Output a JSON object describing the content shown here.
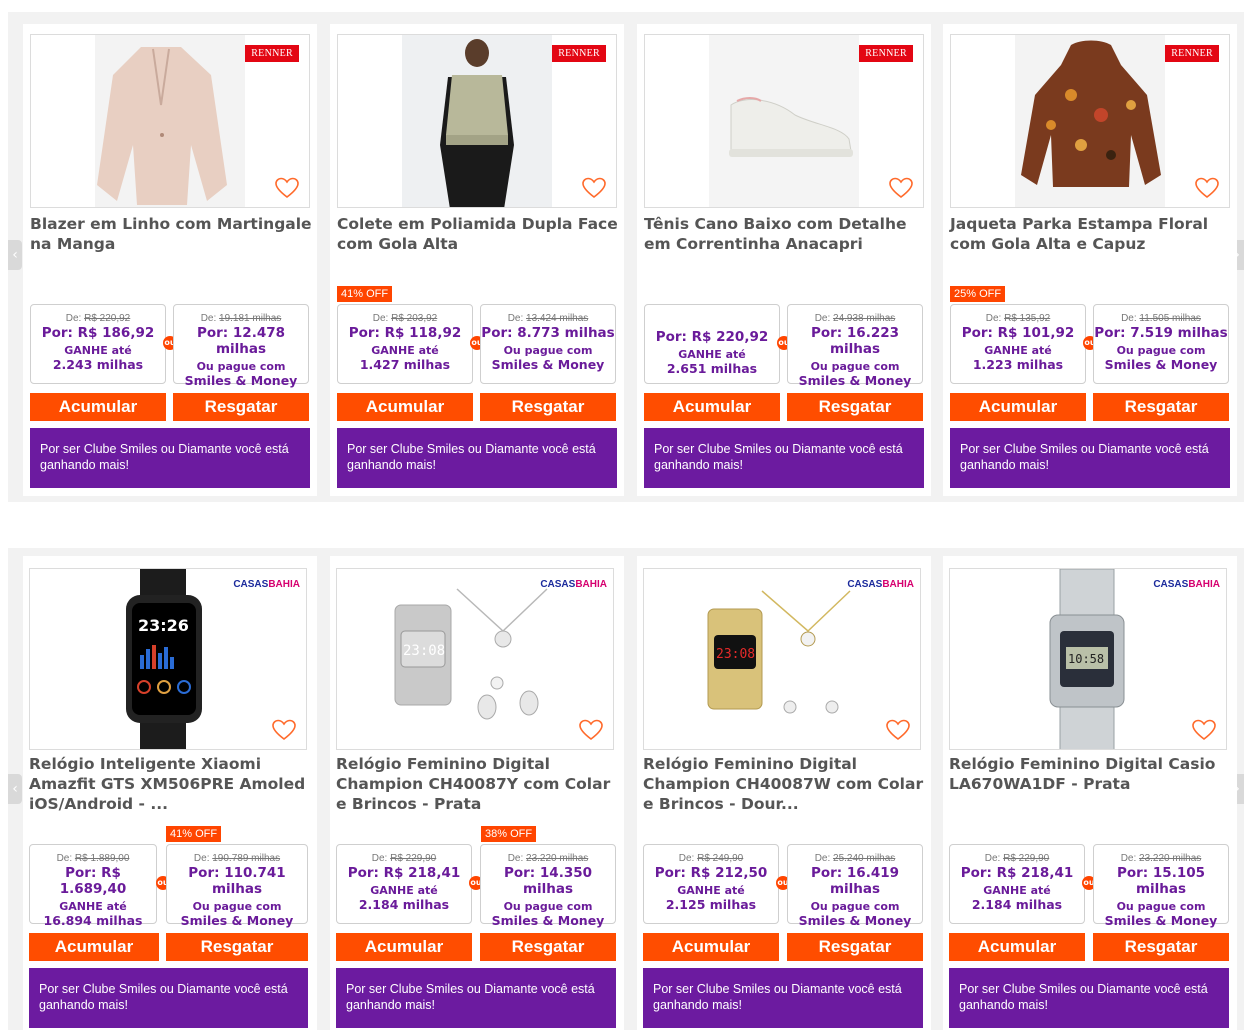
{
  "common": {
    "acumular": "Acumular",
    "resgatar": "Resgatar",
    "banner": "Por ser Clube Smiles ou Diamante você está ganhando mais!",
    "de_label": "De: ",
    "ganhe": "GANHE até",
    "ou_pague": "Ou pague com",
    "smiles_money": "Smiles & Money",
    "ou": "ou"
  },
  "brands": {
    "renner": "RENNER",
    "casas_a": "CASAS",
    "casas_b": "BAHIA"
  },
  "row1": [
    {
      "title": "Blazer em Linho com Martingale na Manga",
      "discount": "",
      "was_price": "R$ 220,92",
      "price": "Por: R$ 186,92",
      "gain": "2.243 milhas",
      "was_miles": "19.181 milhas",
      "miles": "Por: 12.478 milhas"
    },
    {
      "title": "Colete em Poliamida Dupla Face com Gola Alta",
      "discount": "41% OFF",
      "was_price": "R$ 203,92",
      "price": "Por: R$ 118,92",
      "gain": "1.427 milhas",
      "was_miles": "13.424 milhas",
      "miles": "Por: 8.773 milhas"
    },
    {
      "title": "Tênis Cano Baixo com Detalhe em Correntinha Anacapri",
      "discount": "",
      "was_price": "",
      "price": "Por: R$ 220,92",
      "gain": "2.651 milhas",
      "was_miles": "24.938 milhas",
      "miles": "Por: 16.223 milhas"
    },
    {
      "title": "Jaqueta Parka Estampa Floral com Gola Alta e Capuz",
      "discount": "25% OFF",
      "was_price": "R$ 135,92",
      "price": "Por: R$ 101,92",
      "gain": "1.223 milhas",
      "was_miles": "11.505 milhas",
      "miles": "Por: 7.519 milhas"
    }
  ],
  "row2": [
    {
      "title": "Relógio Inteligente Xiaomi Amazfit GTS XM506PRE Amoled iOS/Android - ...",
      "discount": "41% OFF",
      "was_price": "R$ 1.889,00",
      "price": "Por: R$ 1.689,40",
      "gain": "16.894 milhas",
      "was_miles": "190.789 milhas",
      "miles": "Por: 110.741 milhas"
    },
    {
      "title": "Relógio Feminino Digital Champion CH40087Y com Colar e Brincos - Prata",
      "discount": "38% OFF",
      "was_price": "R$ 229,90",
      "price": "Por: R$ 218,41",
      "gain": "2.184 milhas",
      "was_miles": "23.220 milhas",
      "miles": "Por: 14.350 milhas"
    },
    {
      "title": "Relógio Feminino Digital Champion CH40087W com Colar e Brincos - Dour...",
      "discount": "",
      "was_price": "R$ 249,90",
      "price": "Por: R$ 212,50",
      "gain": "2.125 milhas",
      "was_miles": "25.240 milhas",
      "miles": "Por: 16.419 milhas"
    },
    {
      "title": "Relógio Feminino Digital Casio LA670WA1DF - Prata",
      "discount": "",
      "was_price": "R$ 229,90",
      "price": "Por: R$ 218,41",
      "gain": "2.184 milhas",
      "was_miles": "23.220 milhas",
      "miles": "Por: 15.105 milhas"
    }
  ],
  "watch_display": {
    "smart_time": "23:26",
    "silver_time": "23:08",
    "gold_time": "23:08",
    "casio_time": "10:58"
  },
  "colors": {
    "accent": "#ff4d00",
    "purple": "#6c1ba0",
    "renner_red": "#e30613"
  }
}
